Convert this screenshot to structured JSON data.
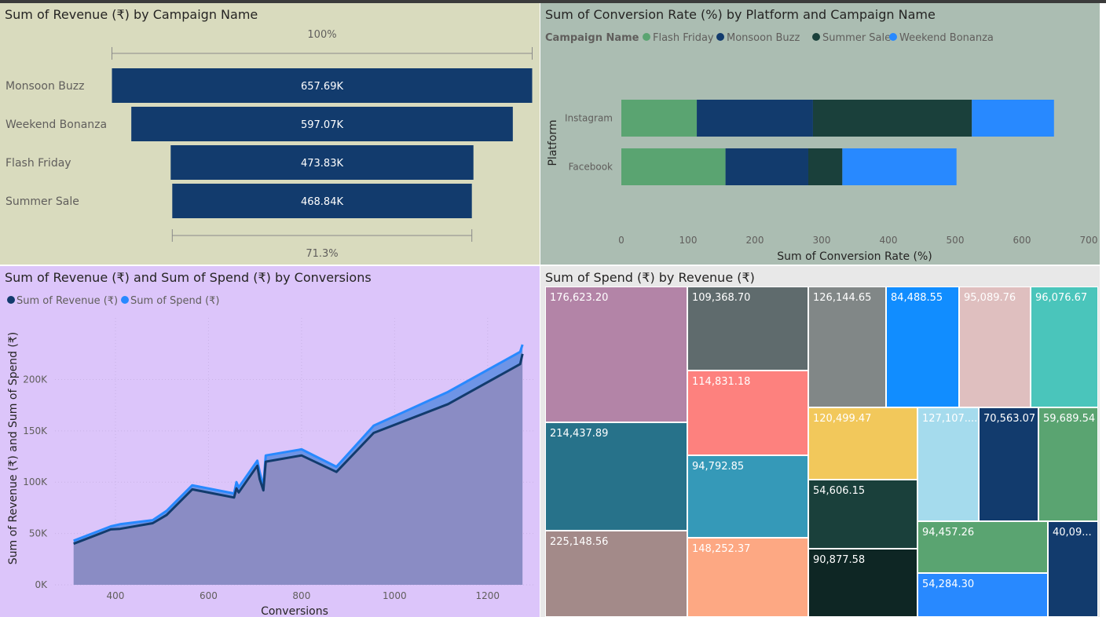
{
  "chart_data": [
    {
      "type": "bar",
      "title": "Sum of Revenue (₹) by Campaign Name",
      "subtype": "funnel",
      "categories": [
        "Monsoon Buzz",
        "Weekend Bonanza",
        "Flash Friday",
        "Summer Sale"
      ],
      "values": [
        657.69,
        597.07,
        473.83,
        468.84
      ],
      "data_labels": [
        "657.69K",
        "597.07K",
        "473.83K",
        "468.84K"
      ],
      "top_label": "100%",
      "bottom_label": "71.3%",
      "bar_color": "#123b6d",
      "background": "#d9dbbe"
    },
    {
      "type": "bar",
      "title": "Sum of Conversion Rate (%) by Platform and Campaign Name",
      "orientation": "horizontal",
      "stacked": true,
      "legend_title": "Campaign Name",
      "legend_position": "top-left",
      "categories": [
        "Instagram",
        "Facebook"
      ],
      "series": [
        {
          "name": "Flash Friday",
          "color": "#5aa471",
          "values": [
            113,
            156
          ]
        },
        {
          "name": "Monsoon Buzz",
          "color": "#123b6d",
          "values": [
            174,
            124
          ]
        },
        {
          "name": "Summer Sale",
          "color": "#1a403b",
          "values": [
            238,
            51
          ]
        },
        {
          "name": "Weekend Bonanza",
          "color": "#2889ff",
          "values": [
            123,
            171
          ]
        }
      ],
      "xlabel": "Sum of Conversion Rate (%)",
      "ylabel": "Platform",
      "xlim": [
        0,
        700
      ],
      "xticks": [
        "0",
        "100",
        "200",
        "300",
        "400",
        "500",
        "600",
        "700"
      ],
      "background": "#abbdb2"
    },
    {
      "type": "area",
      "title": "Sum of Revenue (₹) and Sum of Spend (₹) by Conversions",
      "legend_position": "top-left",
      "xlabel": "Conversions",
      "ylabel": "Sum of Revenue (₹) and Sum of Spend (₹)",
      "xlim": [
        270,
        1300
      ],
      "ylim": [
        0,
        260000
      ],
      "xticks": [
        "400",
        "600",
        "800",
        "1000",
        "1200"
      ],
      "yticks": [
        "0K",
        "50K",
        "100K",
        "150K",
        "200K"
      ],
      "x": [
        310,
        390,
        410,
        480,
        510,
        565,
        655,
        660,
        665,
        705,
        710,
        718,
        723,
        800,
        875,
        955,
        1115,
        1270,
        1275
      ],
      "series": [
        {
          "name": "Sum of Revenue (₹)",
          "color": "#123b6d",
          "values": [
            40000,
            54000,
            54500,
            60000,
            68000,
            93000,
            85000,
            94000,
            90000,
            116000,
            103000,
            92000,
            120000,
            126000,
            110000,
            148000,
            176000,
            215000,
            225000
          ]
        },
        {
          "name": "Sum of Spend (₹)",
          "color": "#2889ff",
          "values": [
            43000,
            57000,
            59000,
            63000,
            72000,
            97000,
            89000,
            100000,
            95000,
            121000,
            110000,
            96000,
            126000,
            132000,
            115000,
            155000,
            188000,
            227000,
            234000
          ]
        }
      ],
      "background": "#dcc5fa"
    },
    {
      "type": "heatmap",
      "subtype": "treemap",
      "title": "Sum of Spend (₹) by Revenue (₹)",
      "labels": [
        "176,623.20",
        "214,437.89",
        "225,148.56",
        "109,368.70",
        "114,831.18",
        "94,792.85",
        "148,252.37",
        "126,144.65",
        "84,488.55",
        "95,089.76",
        "96,076.67",
        "120,499.47",
        "54,606.15",
        "90,877.58",
        "127,107....",
        "70,563.07",
        "59,689.54",
        "94,457.26",
        "54,284.30",
        "40,09..."
      ],
      "colors": [
        "#b384a7",
        "#27728a",
        "#a38a89",
        "#5f6b6d",
        "#fd817e",
        "#3599b8",
        "#fda883",
        "#818787",
        "#118dff",
        "#dfbfbf",
        "#4ac5bb",
        "#f2c85b",
        "#1a403b",
        "#0e2624",
        "#a5dbed",
        "#123b6d",
        "#5aa471",
        "#5aa471",
        "#2889ff",
        "#123b6d"
      ],
      "background": "#e8e8e8"
    }
  ]
}
